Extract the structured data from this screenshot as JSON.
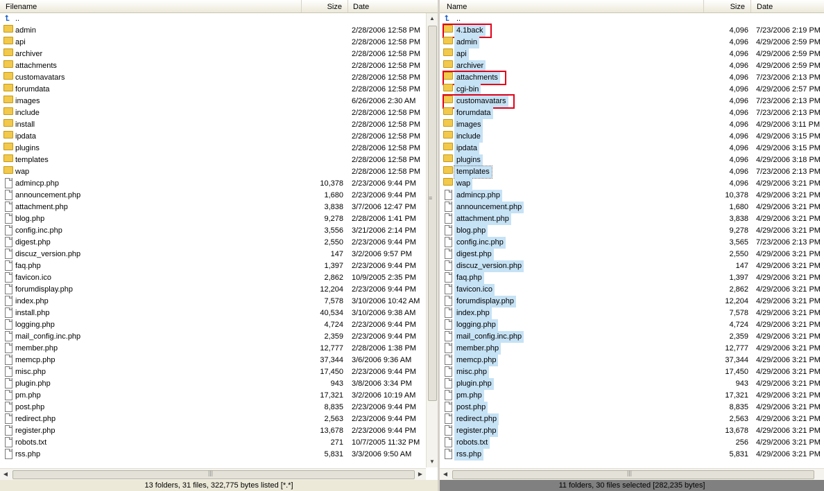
{
  "left": {
    "columns": {
      "name": "Filename",
      "size": "Size",
      "date": "Date"
    },
    "parent": "..",
    "rows": [
      {
        "name": "admin",
        "size": "",
        "date": "2/28/2006 12:58 PM",
        "type": "folder"
      },
      {
        "name": "api",
        "size": "",
        "date": "2/28/2006 12:58 PM",
        "type": "folder"
      },
      {
        "name": "archiver",
        "size": "",
        "date": "2/28/2006 12:58 PM",
        "type": "folder"
      },
      {
        "name": "attachments",
        "size": "",
        "date": "2/28/2006 12:58 PM",
        "type": "folder"
      },
      {
        "name": "customavatars",
        "size": "",
        "date": "2/28/2006 12:58 PM",
        "type": "folder"
      },
      {
        "name": "forumdata",
        "size": "",
        "date": "2/28/2006 12:58 PM",
        "type": "folder"
      },
      {
        "name": "images",
        "size": "",
        "date": "6/26/2006 2:30 AM",
        "type": "folder"
      },
      {
        "name": "include",
        "size": "",
        "date": "2/28/2006 12:58 PM",
        "type": "folder"
      },
      {
        "name": "install",
        "size": "",
        "date": "2/28/2006 12:58 PM",
        "type": "folder"
      },
      {
        "name": "ipdata",
        "size": "",
        "date": "2/28/2006 12:58 PM",
        "type": "folder"
      },
      {
        "name": "plugins",
        "size": "",
        "date": "2/28/2006 12:58 PM",
        "type": "folder"
      },
      {
        "name": "templates",
        "size": "",
        "date": "2/28/2006 12:58 PM",
        "type": "folder"
      },
      {
        "name": "wap",
        "size": "",
        "date": "2/28/2006 12:58 PM",
        "type": "folder"
      },
      {
        "name": "admincp.php",
        "size": "10,378",
        "date": "2/23/2006 9:44 PM",
        "type": "file"
      },
      {
        "name": "announcement.php",
        "size": "1,680",
        "date": "2/23/2006 9:44 PM",
        "type": "file"
      },
      {
        "name": "attachment.php",
        "size": "3,838",
        "date": "3/7/2006 12:47 PM",
        "type": "file"
      },
      {
        "name": "blog.php",
        "size": "9,278",
        "date": "2/28/2006 1:41 PM",
        "type": "file"
      },
      {
        "name": "config.inc.php",
        "size": "3,556",
        "date": "3/21/2006 2:14 PM",
        "type": "file"
      },
      {
        "name": "digest.php",
        "size": "2,550",
        "date": "2/23/2006 9:44 PM",
        "type": "file"
      },
      {
        "name": "discuz_version.php",
        "size": "147",
        "date": "3/2/2006 9:57 PM",
        "type": "file"
      },
      {
        "name": "faq.php",
        "size": "1,397",
        "date": "2/23/2006 9:44 PM",
        "type": "file"
      },
      {
        "name": "favicon.ico",
        "size": "2,862",
        "date": "10/9/2005 2:35 PM",
        "type": "file"
      },
      {
        "name": "forumdisplay.php",
        "size": "12,204",
        "date": "2/23/2006 9:44 PM",
        "type": "file"
      },
      {
        "name": "index.php",
        "size": "7,578",
        "date": "3/10/2006 10:42 AM",
        "type": "file"
      },
      {
        "name": "install.php",
        "size": "40,534",
        "date": "3/10/2006 9:38 AM",
        "type": "file"
      },
      {
        "name": "logging.php",
        "size": "4,724",
        "date": "2/23/2006 9:44 PM",
        "type": "file"
      },
      {
        "name": "mail_config.inc.php",
        "size": "2,359",
        "date": "2/23/2006 9:44 PM",
        "type": "file"
      },
      {
        "name": "member.php",
        "size": "12,777",
        "date": "2/28/2006 1:38 PM",
        "type": "file"
      },
      {
        "name": "memcp.php",
        "size": "37,344",
        "date": "3/6/2006 9:36 AM",
        "type": "file"
      },
      {
        "name": "misc.php",
        "size": "17,450",
        "date": "2/23/2006 9:44 PM",
        "type": "file"
      },
      {
        "name": "plugin.php",
        "size": "943",
        "date": "3/8/2006 3:34 PM",
        "type": "file"
      },
      {
        "name": "pm.php",
        "size": "17,321",
        "date": "3/2/2006 10:19 AM",
        "type": "file"
      },
      {
        "name": "post.php",
        "size": "8,835",
        "date": "2/23/2006 9:44 PM",
        "type": "file"
      },
      {
        "name": "redirect.php",
        "size": "2,563",
        "date": "2/23/2006 9:44 PM",
        "type": "file"
      },
      {
        "name": "register.php",
        "size": "13,678",
        "date": "2/23/2006 9:44 PM",
        "type": "file"
      },
      {
        "name": "robots.txt",
        "size": "271",
        "date": "10/7/2005 11:32 PM",
        "type": "file"
      },
      {
        "name": "rss.php",
        "size": "5,831",
        "date": "3/3/2006 9:50 AM",
        "type": "file"
      }
    ],
    "status": "13 folders, 31 files, 322,775 bytes listed [*.*]"
  },
  "right": {
    "columns": {
      "name": "Name",
      "size": "Size",
      "date": "Date"
    },
    "parent": "..",
    "rows": [
      {
        "name": "4.1back",
        "size": "4,096",
        "date": "7/23/2006 2:19 PM",
        "type": "folder",
        "highlight": true
      },
      {
        "name": "admin",
        "size": "4,096",
        "date": "4/29/2006 2:59 PM",
        "type": "folder"
      },
      {
        "name": "api",
        "size": "4,096",
        "date": "4/29/2006 2:59 PM",
        "type": "folder"
      },
      {
        "name": "archiver",
        "size": "4,096",
        "date": "4/29/2006 2:59 PM",
        "type": "folder"
      },
      {
        "name": "attachments",
        "size": "4,096",
        "date": "7/23/2006 2:13 PM",
        "type": "folder",
        "highlight": true
      },
      {
        "name": "cgi-bin",
        "size": "4,096",
        "date": "4/29/2006 2:57 PM",
        "type": "folder"
      },
      {
        "name": "customavatars",
        "size": "4,096",
        "date": "7/23/2006 2:13 PM",
        "type": "folder",
        "highlight": true
      },
      {
        "name": "forumdata",
        "size": "4,096",
        "date": "7/23/2006 2:13 PM",
        "type": "folder"
      },
      {
        "name": "images",
        "size": "4,096",
        "date": "4/29/2006 3:11 PM",
        "type": "folder"
      },
      {
        "name": "include",
        "size": "4,096",
        "date": "4/29/2006 3:15 PM",
        "type": "folder"
      },
      {
        "name": "ipdata",
        "size": "4,096",
        "date": "4/29/2006 3:15 PM",
        "type": "folder"
      },
      {
        "name": "plugins",
        "size": "4,096",
        "date": "4/29/2006 3:18 PM",
        "type": "folder"
      },
      {
        "name": "templates",
        "size": "4,096",
        "date": "7/23/2006 2:13 PM",
        "type": "folder",
        "focus": true
      },
      {
        "name": "wap",
        "size": "4,096",
        "date": "4/29/2006 3:21 PM",
        "type": "folder"
      },
      {
        "name": "admincp.php",
        "size": "10,378",
        "date": "4/29/2006 3:21 PM",
        "type": "file"
      },
      {
        "name": "announcement.php",
        "size": "1,680",
        "date": "4/29/2006 3:21 PM",
        "type": "file"
      },
      {
        "name": "attachment.php",
        "size": "3,838",
        "date": "4/29/2006 3:21 PM",
        "type": "file"
      },
      {
        "name": "blog.php",
        "size": "9,278",
        "date": "4/29/2006 3:21 PM",
        "type": "file"
      },
      {
        "name": "config.inc.php",
        "size": "3,565",
        "date": "7/23/2006 2:13 PM",
        "type": "file"
      },
      {
        "name": "digest.php",
        "size": "2,550",
        "date": "4/29/2006 3:21 PM",
        "type": "file"
      },
      {
        "name": "discuz_version.php",
        "size": "147",
        "date": "4/29/2006 3:21 PM",
        "type": "file"
      },
      {
        "name": "faq.php",
        "size": "1,397",
        "date": "4/29/2006 3:21 PM",
        "type": "file"
      },
      {
        "name": "favicon.ico",
        "size": "2,862",
        "date": "4/29/2006 3:21 PM",
        "type": "file"
      },
      {
        "name": "forumdisplay.php",
        "size": "12,204",
        "date": "4/29/2006 3:21 PM",
        "type": "file"
      },
      {
        "name": "index.php",
        "size": "7,578",
        "date": "4/29/2006 3:21 PM",
        "type": "file"
      },
      {
        "name": "logging.php",
        "size": "4,724",
        "date": "4/29/2006 3:21 PM",
        "type": "file"
      },
      {
        "name": "mail_config.inc.php",
        "size": "2,359",
        "date": "4/29/2006 3:21 PM",
        "type": "file"
      },
      {
        "name": "member.php",
        "size": "12,777",
        "date": "4/29/2006 3:21 PM",
        "type": "file"
      },
      {
        "name": "memcp.php",
        "size": "37,344",
        "date": "4/29/2006 3:21 PM",
        "type": "file"
      },
      {
        "name": "misc.php",
        "size": "17,450",
        "date": "4/29/2006 3:21 PM",
        "type": "file"
      },
      {
        "name": "plugin.php",
        "size": "943",
        "date": "4/29/2006 3:21 PM",
        "type": "file"
      },
      {
        "name": "pm.php",
        "size": "17,321",
        "date": "4/29/2006 3:21 PM",
        "type": "file"
      },
      {
        "name": "post.php",
        "size": "8,835",
        "date": "4/29/2006 3:21 PM",
        "type": "file"
      },
      {
        "name": "redirect.php",
        "size": "2,563",
        "date": "4/29/2006 3:21 PM",
        "type": "file"
      },
      {
        "name": "register.php",
        "size": "13,678",
        "date": "4/29/2006 3:21 PM",
        "type": "file"
      },
      {
        "name": "robots.txt",
        "size": "256",
        "date": "4/29/2006 3:21 PM",
        "type": "file"
      },
      {
        "name": "rss.php",
        "size": "5,831",
        "date": "4/29/2006 3:21 PM",
        "type": "file"
      }
    ],
    "status": "11 folders, 30 files selected [282,235 bytes]"
  },
  "colors": {
    "selection": "#c6e2f5",
    "highlight_box": "#e0001a",
    "folder": "#f2c94c"
  }
}
